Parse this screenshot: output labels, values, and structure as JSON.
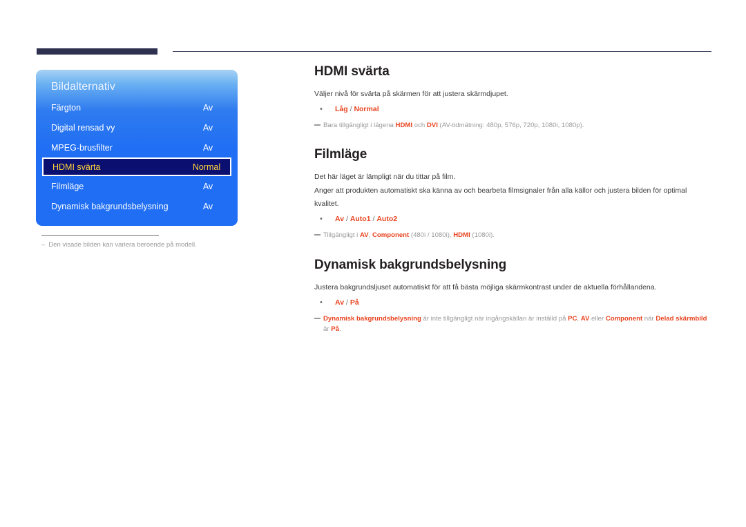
{
  "header": {
    "thick_rule": "thick-navy-rule",
    "thin_rule": "thin-rule"
  },
  "osd": {
    "title": "Bildalternativ",
    "rows": [
      {
        "label": "Färgton",
        "value": "Av",
        "selected": false
      },
      {
        "label": "Digital rensad vy",
        "value": "Av",
        "selected": false
      },
      {
        "label": "MPEG-brusfilter",
        "value": "Av",
        "selected": false
      },
      {
        "label": "HDMI svärta",
        "value": "Normal",
        "selected": true
      },
      {
        "label": "Filmläge",
        "value": "Av",
        "selected": false
      },
      {
        "label": "Dynamisk bakgrundsbelysning",
        "value": "Av",
        "selected": false
      }
    ],
    "colors": {
      "panel_top": "#a8d2f5",
      "panel_bottom": "#1f6ef4",
      "selected_bg": "#0b1070",
      "selected_text": "#ffd23b"
    }
  },
  "image_note": {
    "dash": "–",
    "text": "Den visade bilden kan variera beroende på modell."
  },
  "sections": [
    {
      "title": "HDMI svärta",
      "paragraphs": [
        "Väljer nivå för svärta på skärmen för att justera skärmdjupet."
      ],
      "bullet": {
        "dot": "•",
        "parts": [
          {
            "text": "Låg",
            "style": "hl"
          },
          {
            "text": " / ",
            "style": "sep"
          },
          {
            "text": "Normal",
            "style": "hl"
          }
        ]
      },
      "note": [
        {
          "text": "Bara tillgängligt i lägena ",
          "style": "dim"
        },
        {
          "text": "HDMI",
          "style": "hl"
        },
        {
          "text": " och ",
          "style": "dim"
        },
        {
          "text": "DVI",
          "style": "hl"
        },
        {
          "text": " (AV-tidmätning: 480p, 576p, 720p, 1080i, 1080p).",
          "style": "dim"
        }
      ]
    },
    {
      "title": "Filmläge",
      "paragraphs": [
        "Det här läget är lämpligt när du tittar på film.",
        "Anger att produkten automatiskt ska känna av och bearbeta filmsignaler från alla källor och justera bilden för optimal kvalitet."
      ],
      "bullet": {
        "dot": "•",
        "parts": [
          {
            "text": "Av",
            "style": "hl"
          },
          {
            "text": " / ",
            "style": "sep"
          },
          {
            "text": "Auto1",
            "style": "hl"
          },
          {
            "text": " / ",
            "style": "sep"
          },
          {
            "text": "Auto2",
            "style": "hl"
          }
        ]
      },
      "note": [
        {
          "text": "Tillgängligt i ",
          "style": "dim"
        },
        {
          "text": "AV",
          "style": "hl"
        },
        {
          "text": ", ",
          "style": "dim"
        },
        {
          "text": "Component",
          "style": "hl"
        },
        {
          "text": " (480i / 1080i), ",
          "style": "dim"
        },
        {
          "text": "HDMI",
          "style": "hl"
        },
        {
          "text": " (1080i).",
          "style": "dim"
        }
      ]
    },
    {
      "title": "Dynamisk bakgrundsbelysning",
      "paragraphs": [
        "Justera bakgrundsljuset automatiskt för att få bästa möjliga skärmkontrast under de aktuella förhållandena."
      ],
      "bullet": {
        "dot": "•",
        "parts": [
          {
            "text": "Av",
            "style": "hl"
          },
          {
            "text": " / ",
            "style": "sep"
          },
          {
            "text": "På",
            "style": "hl"
          }
        ]
      },
      "note": [
        {
          "text": "Dynamisk bakgrundsbelysning",
          "style": "hl"
        },
        {
          "text": " är inte tillgängligt när ingångskällan är inställd på ",
          "style": "dim"
        },
        {
          "text": "PC",
          "style": "hl"
        },
        {
          "text": ", ",
          "style": "dim"
        },
        {
          "text": "AV",
          "style": "hl"
        },
        {
          "text": " eller ",
          "style": "dim"
        },
        {
          "text": "Component",
          "style": "hl"
        },
        {
          "text": " när ",
          "style": "dim"
        },
        {
          "text": "Delad skärmbild",
          "style": "hl"
        },
        {
          "text": " är ",
          "style": "dim"
        },
        {
          "text": "På",
          "style": "hl"
        },
        {
          "text": ".",
          "style": "dim"
        }
      ]
    }
  ]
}
